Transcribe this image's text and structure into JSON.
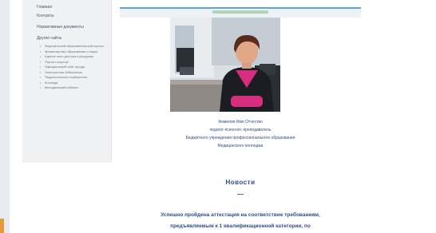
{
  "sidebar": {
    "links": [
      "Главная",
      "Контакты",
      "Нормативные документы"
    ],
    "section_title": "Другие сайты",
    "items": [
      "Федеральный образовательный портал",
      "Министерство образования и науки",
      "Единое окно доступа к ресурсам",
      "Портал госуслуг",
      "Официальный сайт города",
      "Электронная библиотека",
      "Педагогическое сообщество",
      "Колледж",
      "Методический кабинет"
    ]
  },
  "header": {
    "strip_label": ""
  },
  "profile": {
    "photo_alt": "Фото руководителя",
    "name": "Фамилия Имя Отчество",
    "role": "педагог-психолог, преподаватель",
    "institution": "Бюджетного учреждения профессионального образования",
    "college": "Медицинского колледжа"
  },
  "news": {
    "title": "Новости",
    "separator": "—",
    "text_line1": "Успешно пройдена аттестация на соответствие требованиям,",
    "text_line2": "предъявляемым к 1 квалификационной категории, по"
  }
}
